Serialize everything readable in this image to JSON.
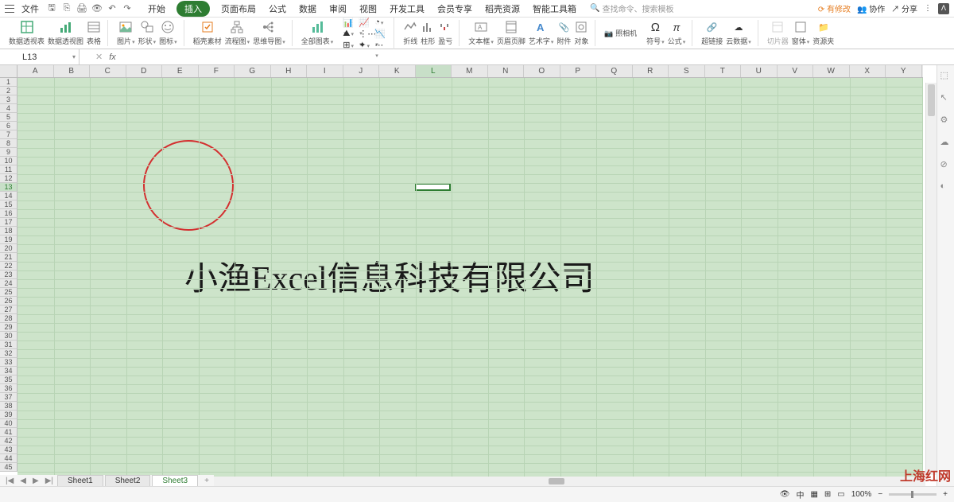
{
  "menubar": {
    "file": "文件",
    "tabs": [
      "开始",
      "插入",
      "页面布局",
      "公式",
      "数据",
      "审阅",
      "视图",
      "开发工具",
      "会员专享",
      "稻壳资源",
      "智能工具箱"
    ],
    "active_tab_index": 1,
    "search_placeholder": "查找命令、搜索模板",
    "pending": "有修改",
    "collab": "协作",
    "share": "分享"
  },
  "ribbon": {
    "g1": {
      "l1": "数据透视表",
      "l2": "数据透视图",
      "l3": "表格"
    },
    "g2": {
      "l1": "图片",
      "l2": "形状",
      "l3": "图标"
    },
    "g3": {
      "l1": "稻壳素材",
      "l2": "流程图",
      "l3": "思维导图"
    },
    "g4": "全部图表",
    "g5": {
      "l1": "折线",
      "l2": "柱形",
      "l3": "盈亏"
    },
    "g6": {
      "l1": "文本框",
      "l2": "页眉页脚",
      "l3": "艺术字",
      "l4": "附件",
      "l5": "对象"
    },
    "g7": "照相机",
    "g8": {
      "l1": "符号",
      "l2": "公式"
    },
    "g9": {
      "l1": "超链接",
      "l2": "云数据"
    },
    "g10": {
      "l1": "切片器",
      "l2": "窗体",
      "l3": "资源夹"
    }
  },
  "formula": {
    "cell_ref": "L13",
    "fx": "fx"
  },
  "columns": [
    "A",
    "B",
    "C",
    "D",
    "E",
    "F",
    "G",
    "H",
    "I",
    "J",
    "K",
    "L",
    "M",
    "N",
    "O",
    "P",
    "Q",
    "R",
    "S",
    "T",
    "U",
    "V",
    "W",
    "X",
    "Y"
  ],
  "active_col_index": 11,
  "row_count": 45,
  "active_row": 13,
  "watermark_text": "小渔Excel信息科技有限公司",
  "sheets": {
    "nav": [
      "|◀",
      "◀",
      "▶",
      "▶|"
    ],
    "tabs": [
      "Sheet1",
      "Sheet2",
      "Sheet3"
    ],
    "active_index": 2
  },
  "status": {
    "zoom": "100%",
    "views": [
      "⊞",
      "⊡",
      "▭",
      "▦"
    ]
  },
  "brand": "上海红网"
}
